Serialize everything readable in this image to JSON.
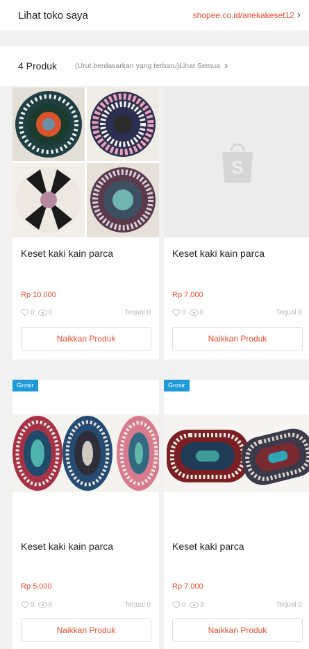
{
  "shop": {
    "label": "Lihat toko saya",
    "url": "shopee.co.id/anekakeset12"
  },
  "products_header": {
    "count": "4 Produk",
    "sort": "(Urut berdasarkan yang terbaru)",
    "see_all": "Lihat Semua"
  },
  "products": [
    {
      "title": "Keset kaki kain parca",
      "price": "Rp 10.000",
      "likes": "0",
      "views": "0",
      "sold": "Terjual 0",
      "button": "Naikkan Produk"
    },
    {
      "title": "Keset kaki kain parca",
      "price": "Rp 7.000",
      "likes": "0",
      "views": "0",
      "sold": "Terjual 0",
      "button": "Naikkan Produk"
    },
    {
      "badge": "Grosir",
      "title": "Keset kaki kain parca",
      "price": "Rp 5.000",
      "likes": "0",
      "views": "6",
      "sold": "Terjual 0",
      "button": "Naikkan Produk"
    },
    {
      "badge": "Grosir",
      "title": "Keset kaki parca",
      "price": "Rp 7.000",
      "likes": "0",
      "views": "3",
      "sold": "Terjual 0",
      "button": "Naikkan Produk"
    }
  ],
  "colors": {
    "accent": "#ee4d2d",
    "badge": "#1e9bd7",
    "background": "#f1f1f1"
  },
  "icons": [
    "chevron-right-icon",
    "heart-icon",
    "eye-icon",
    "shopee-bag-icon"
  ]
}
